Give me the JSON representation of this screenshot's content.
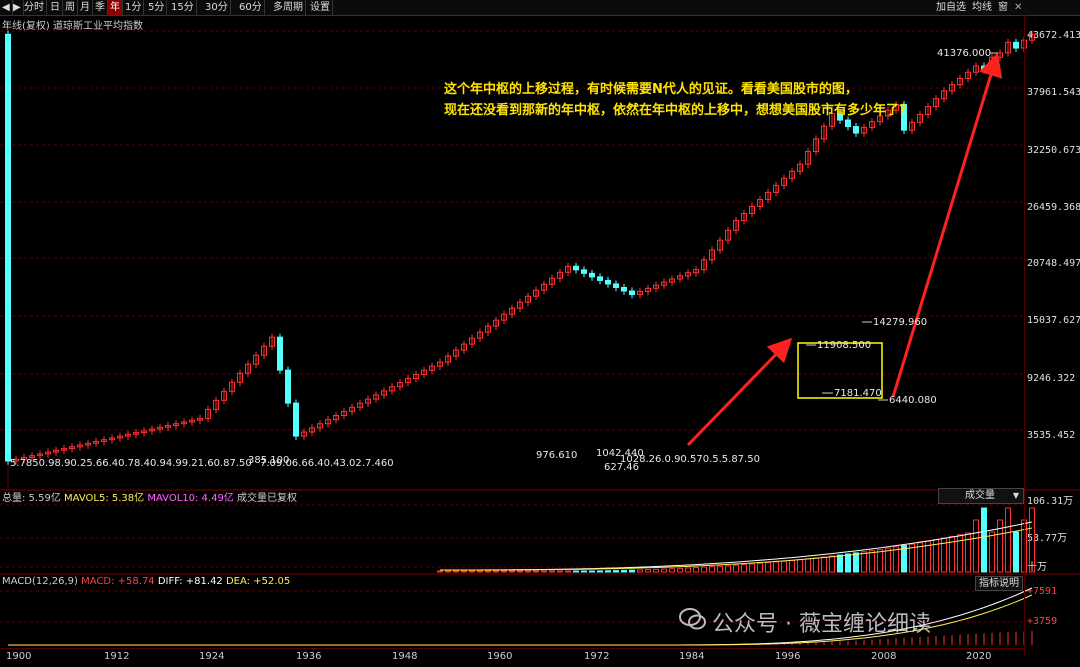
{
  "toolbar": {
    "periods": [
      "分时",
      "日",
      "周",
      "月",
      "季",
      "年",
      "1分",
      "5分",
      "15分",
      "30分",
      "60分",
      "多周期",
      "设置"
    ],
    "active_period": "年",
    "right": [
      "加自选",
      "均线",
      "窗"
    ]
  },
  "title": "年线(复权)  道琼斯工业平均指数",
  "price_axis": [
    "43672.413",
    "37961.543",
    "32250.673",
    "26459.368",
    "20748.497",
    "15037.627",
    "9246.322",
    "3535.452"
  ],
  "annotation": {
    "line1": "这个年中枢的上移过程，有时候需要N代人的见证。看看美国股市的图，",
    "line2": "现在还没看到那新的年中枢，依然在年中枢的上移中，想想美国股市有多少年了？"
  },
  "price_labels": {
    "high": "41376.000",
    "p1": "14279.960",
    "p2": "11908.500",
    "p3": "7181.470",
    "p4": "6440.080",
    "p5": "385.100",
    "p6": "976.610",
    "p7": "1042.440",
    "p8": "627.46",
    "cluster_left": "5.7850.98.90.25.66.40.78.40.94.99.21.60.87.50",
    "cluster_mid": "7.09.06.66.40.43.02.7.460",
    "cluster_right": "1028.26.0.90.570.5.5.87.50"
  },
  "volume": {
    "total_label": "总量: 5.59亿",
    "mavol5_label": "MAVOL5: 5.38亿",
    "mavol10_label": "MAVOL10: 4.49亿",
    "adjusted_note": "成交量已复权",
    "dropdown": "成交量",
    "axis": [
      "106.31万",
      "53.77万",
      "十万"
    ]
  },
  "macd": {
    "label": "MACD(12,26,9)",
    "macd_val": "MACD: +58.74",
    "diff_val": "DIFF: +81.42",
    "dea_val": "DEA: +52.05",
    "button": "指标说明",
    "axis": [
      "+7591",
      "+3759"
    ]
  },
  "xaxis": [
    "1900",
    "1912",
    "1924",
    "1936",
    "1948",
    "1960",
    "1972",
    "1984",
    "1996",
    "2008",
    "2020"
  ],
  "watermark": "公众号 · 薇宝缠论细读",
  "colors": {
    "up": "#ff3030",
    "down": "#54ffff",
    "annotation": "#ffe300",
    "box": "#ffff00",
    "grid": "#5a0000"
  },
  "chart_data": {
    "type": "candlestick",
    "title": "道琼斯工业平均指数",
    "x_range": [
      1896,
      2024
    ],
    "y_range": [
      0,
      43672.413
    ],
    "y_scale": "log",
    "key_points": [
      {
        "year": 2024,
        "high": 41376.0
      },
      {
        "year": 2007,
        "high": 14279.96
      },
      {
        "year": 2000,
        "high": 11908.5
      },
      {
        "year": 2002,
        "low": 7181.47
      },
      {
        "year": 2009,
        "low": 6440.08
      }
    ]
  }
}
